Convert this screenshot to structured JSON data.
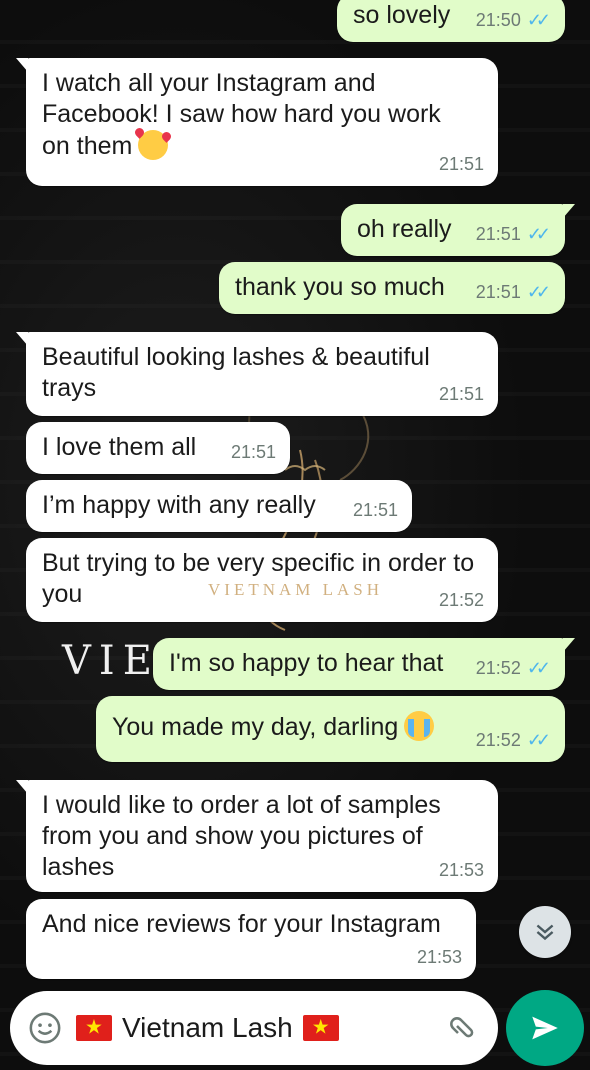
{
  "messages": [
    {
      "id": "m1",
      "dir": "out",
      "text": "so lovely",
      "time": "21:50",
      "read": true
    },
    {
      "id": "m2",
      "dir": "in",
      "text": "I watch all your Instagram and Facebook! I saw how hard you work on them",
      "emoji": "smiling-face-with-hearts",
      "time": "21:51"
    },
    {
      "id": "m3",
      "dir": "out",
      "text": "oh really",
      "time": "21:51",
      "read": true
    },
    {
      "id": "m4",
      "dir": "out",
      "text": "thank you so much",
      "time": "21:51",
      "read": true
    },
    {
      "id": "m5",
      "dir": "in",
      "text": "Beautiful looking lashes & beautiful trays",
      "time": "21:51"
    },
    {
      "id": "m6",
      "dir": "in",
      "text": "I love them all",
      "time": "21:51"
    },
    {
      "id": "m7",
      "dir": "in",
      "text": "I’m happy with any really",
      "time": "21:51"
    },
    {
      "id": "m8",
      "dir": "in",
      "text": "But trying to be very specific in order to you",
      "time": "21:52"
    },
    {
      "id": "m9",
      "dir": "out",
      "text": "I'm so happy to hear that",
      "time": "21:52",
      "read": true
    },
    {
      "id": "m10",
      "dir": "out",
      "text": "You made my day, darling",
      "emoji": "loudly-crying-face",
      "time": "21:52",
      "read": true
    },
    {
      "id": "m11",
      "dir": "in",
      "text": "I would like to order a lot of samples from you and show you pictures of lashes",
      "time": "21:53"
    },
    {
      "id": "m12",
      "dir": "in",
      "text": "And nice reviews for your Instagram",
      "time": "21:53"
    }
  ],
  "watermark": {
    "brand": "VIE",
    "tagline": "VIETNAM LASH"
  },
  "composer": {
    "text": "Vietnam Lash",
    "flag_icon": "vietnam-flag-icon"
  },
  "colors": {
    "incoming": "#ffffff",
    "outgoing": "#e1fcc9",
    "read_ticks": "#4fb6ec",
    "send": "#00a884",
    "background": "#0b0b0b"
  }
}
